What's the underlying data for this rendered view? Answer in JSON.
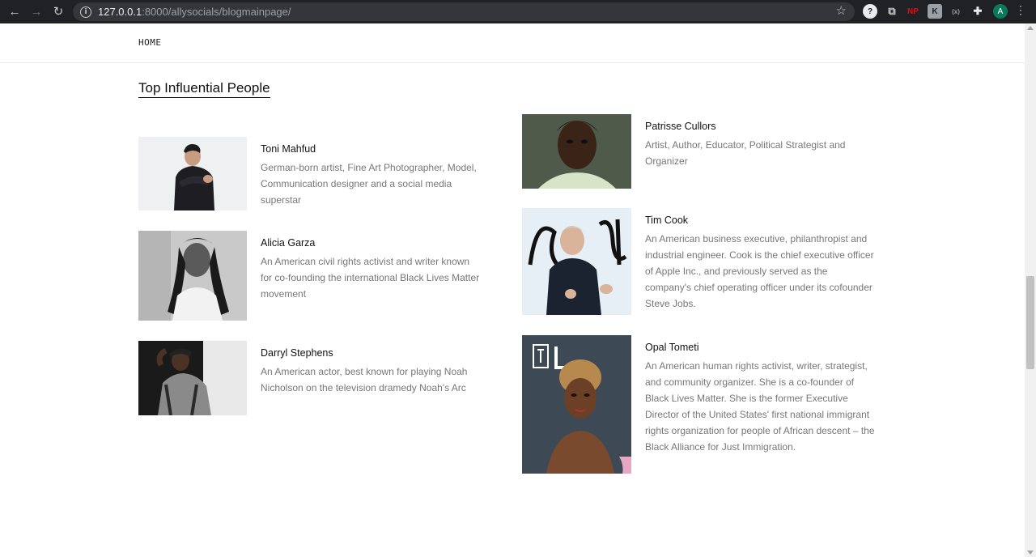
{
  "browser": {
    "url_host": "127.0.0.1",
    "url_rest": ":8000/allysocials/blogmainpage/",
    "avatar_letter": "A",
    "extensions": [
      {
        "name": "help-extension-icon",
        "glyph": "?"
      },
      {
        "name": "copy-extension-icon",
        "glyph": "⧉"
      },
      {
        "name": "np-extension-icon",
        "glyph": "NP"
      },
      {
        "name": "k-extension-icon",
        "glyph": "K"
      },
      {
        "name": "bracket-extension-icon",
        "glyph": "(x)"
      },
      {
        "name": "puzzle-extensions-icon",
        "glyph": "✚"
      }
    ]
  },
  "nav": {
    "home": "HOME"
  },
  "section": {
    "title": "Top Influential People"
  },
  "people": [
    {
      "name": "Toni Mahfud",
      "description": "German-born artist, Fine Art Photographer, Model, Communication designer and a social media superstar"
    },
    {
      "name": "Alicia Garza",
      "description": "An American civil rights activist and writer known for co-founding the international Black Lives Matter movement"
    },
    {
      "name": "Darryl Stephens",
      "description": "An American actor, best known for playing Noah Nicholson on the television dramedy Noah's Arc"
    },
    {
      "name": "Patrisse Cullors",
      "description": "Artist, Author, Educator, Political Strategist and Organizer"
    },
    {
      "name": "Tim Cook",
      "description": "An American business executive, philanthropist and industrial engineer. Cook is the chief executive officer of Apple Inc., and previously served as the company's chief operating officer under its cofounder Steve Jobs."
    },
    {
      "name": "Opal Tometi",
      "description": "An American human rights activist, writer, strategist, and community organizer. She is a co-founder of Black Lives Matter. She is the former Executive Director of the United States' first national immigrant rights organization for people of African descent – the Black Alliance for Just Immigration."
    }
  ]
}
